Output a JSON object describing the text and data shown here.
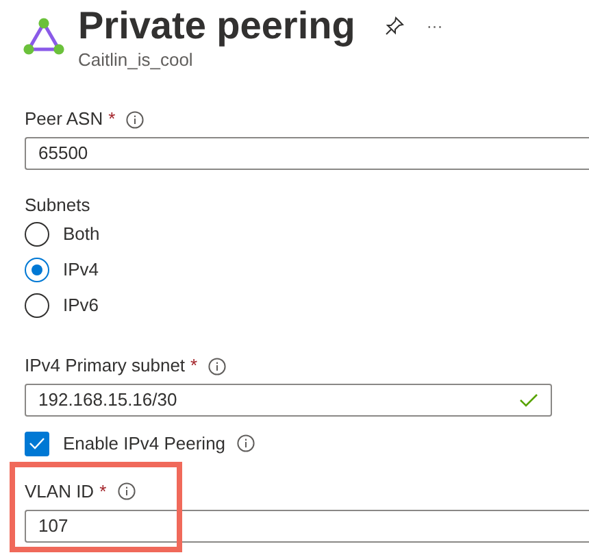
{
  "header": {
    "title": "Private peering",
    "subtitle": "Caitlin_is_cool",
    "more": "···"
  },
  "fields": [
    {
      "kind": "text",
      "label": "Peer ASN",
      "required": "*",
      "info": true,
      "value": "65500",
      "valid": false,
      "open_right": true,
      "highlighted": false
    },
    {
      "kind": "radio",
      "label": "Subnets",
      "options": [
        {
          "label": "Both",
          "selected": false
        },
        {
          "label": "IPv4",
          "selected": true
        },
        {
          "label": "IPv6",
          "selected": false
        }
      ]
    },
    {
      "kind": "text",
      "label": "IPv4 Primary subnet",
      "required": "*",
      "info": true,
      "value": "192.168.15.16/30",
      "valid": true,
      "open_right": false,
      "highlighted": false
    },
    {
      "kind": "checkbox",
      "label": "Enable IPv4 Peering",
      "checked": true,
      "info": true
    },
    {
      "kind": "text",
      "label": "VLAN ID",
      "required": "*",
      "info": true,
      "value": "107",
      "valid": false,
      "open_right": true,
      "highlighted": true
    }
  ]
}
